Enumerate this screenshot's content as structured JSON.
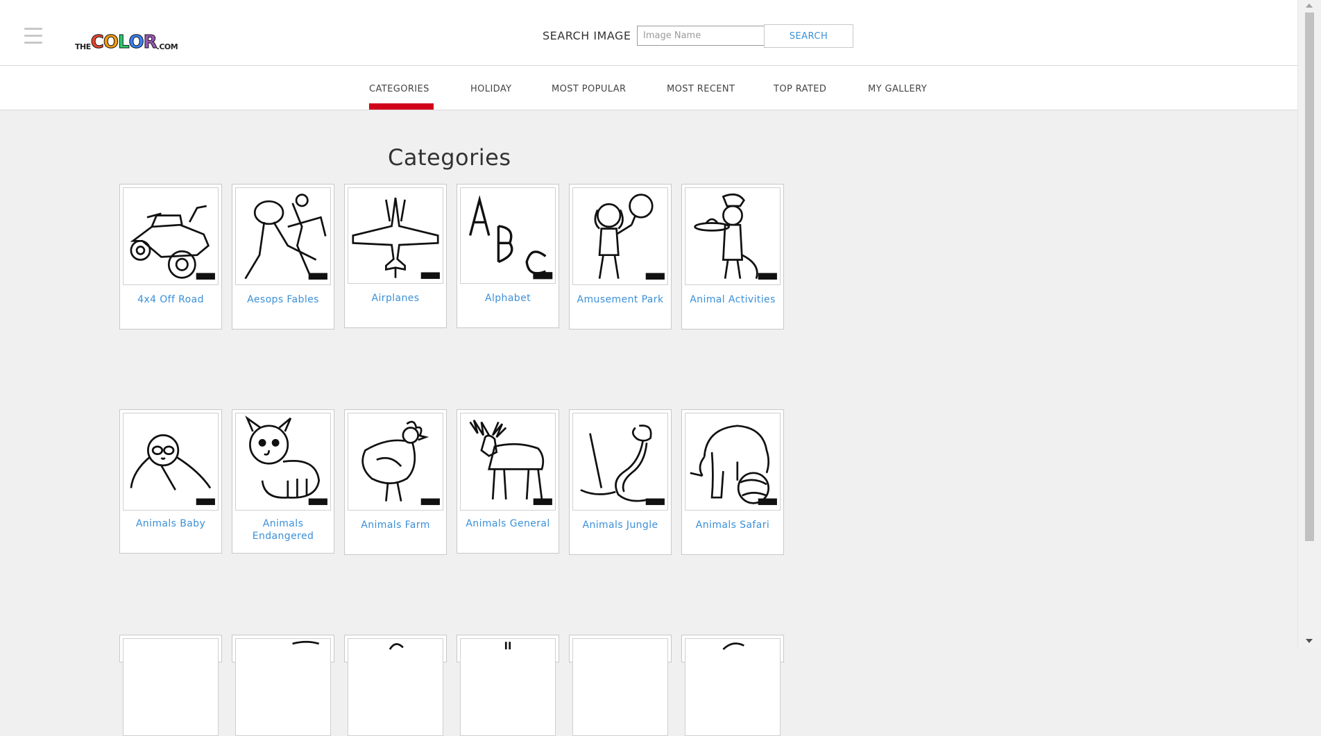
{
  "header": {
    "menu_icon": "hamburger-menu-icon",
    "logo": {
      "prefix": "THE",
      "word": [
        "C",
        "O",
        "L",
        "O",
        "R"
      ],
      "suffix": ".COM",
      "colors": [
        "#e8452c",
        "#f39c12",
        "#2ecc71",
        "#3b82f6",
        "#9b59b6"
      ]
    },
    "search_label": "SEARCH IMAGE",
    "search_placeholder": "Image Name",
    "search_button": "SEARCH"
  },
  "tabs": [
    {
      "label": "CATEGORIES",
      "active": true
    },
    {
      "label": "HOLIDAY",
      "active": false
    },
    {
      "label": "MOST POPULAR",
      "active": false
    },
    {
      "label": "MOST RECENT",
      "active": false
    },
    {
      "label": "TOP RATED",
      "active": false
    },
    {
      "label": "MY GALLERY",
      "active": false
    }
  ],
  "accent_color": "#d0021b",
  "link_color": "#3a8fd8",
  "page_title": "Categories",
  "categories": [
    {
      "label": "4x4 Off Road",
      "icon": "atv-drawing"
    },
    {
      "label": "Aesops Fables",
      "icon": "grasshopper-ant-drawing"
    },
    {
      "label": "Airplanes",
      "icon": "jet-drawing"
    },
    {
      "label": "Alphabet",
      "icon": "abc-letters-drawing"
    },
    {
      "label": "Amusement Park",
      "icon": "girl-cotton-candy-drawing"
    },
    {
      "label": "Animal Activities",
      "icon": "cat-chef-pie-drawing"
    },
    {
      "label": "Animals Baby",
      "icon": "baby-sloth-drawing"
    },
    {
      "label": "Animals Endangered",
      "icon": "red-panda-drawing"
    },
    {
      "label": "Animals Farm",
      "icon": "chicken-drawing"
    },
    {
      "label": "Animals General",
      "icon": "moose-drawing"
    },
    {
      "label": "Animals Jungle",
      "icon": "snake-bat-drawing"
    },
    {
      "label": "Animals Safari",
      "icon": "elephant-ball-drawing"
    }
  ]
}
